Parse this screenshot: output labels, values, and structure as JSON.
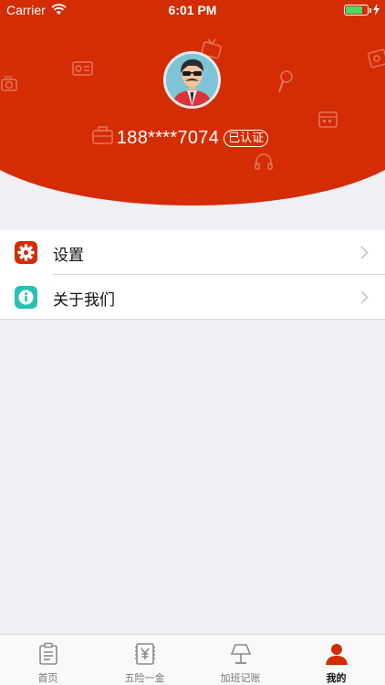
{
  "status_bar": {
    "carrier": "Carrier",
    "time": "6:01 PM",
    "battery_level": 0.8
  },
  "profile": {
    "phone": "188****7074",
    "verified_badge": "已认证"
  },
  "menu": {
    "items": [
      {
        "label": "设置",
        "icon": "gear-icon",
        "icon_color": "#d42c04"
      },
      {
        "label": "关于我们",
        "icon": "info-icon",
        "icon_color": "#29c1b4"
      }
    ]
  },
  "tabbar": {
    "tabs": [
      {
        "label": "首页",
        "icon": "clipboard-icon"
      },
      {
        "label": "五险一金",
        "icon": "yuan-icon"
      },
      {
        "label": "加班记账",
        "icon": "lamp-icon"
      },
      {
        "label": "我的",
        "icon": "person-icon",
        "active": true
      }
    ]
  },
  "colors": {
    "accent": "#d42c04",
    "background": "#efeff4",
    "info": "#29c1b4"
  }
}
